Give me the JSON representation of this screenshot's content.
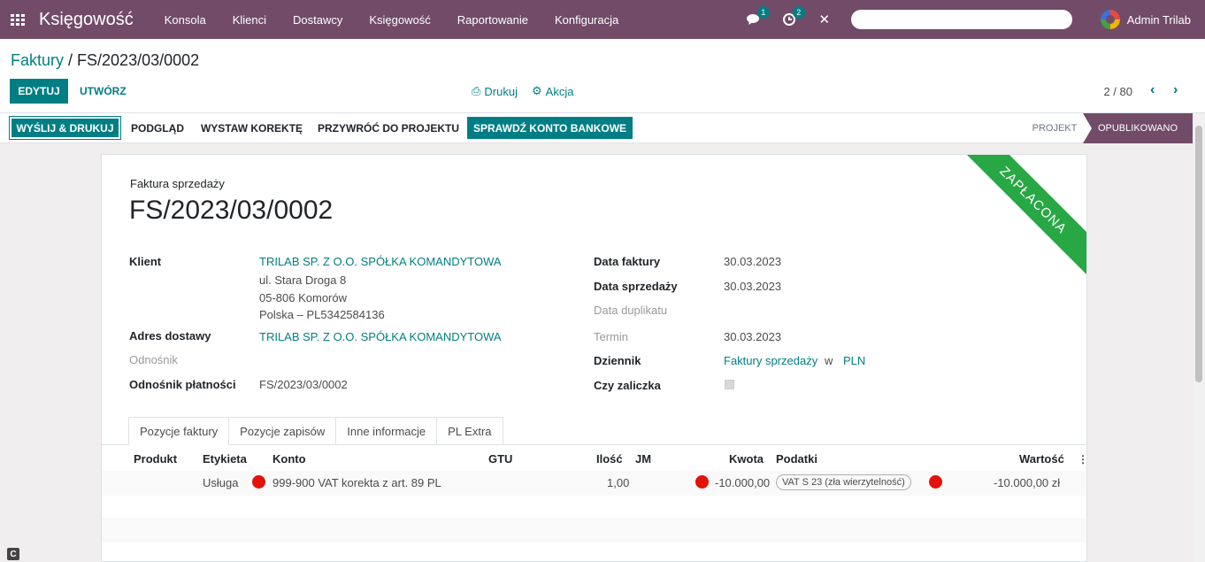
{
  "topbar": {
    "app_title": "Księgowość",
    "menu": [
      "Konsola",
      "Klienci",
      "Dostawcy",
      "Księgowość",
      "Raportowanie",
      "Konfiguracja"
    ],
    "messages_badge": "1",
    "activity_badge": "2",
    "user_name": "Admin Trilab"
  },
  "breadcrumb": {
    "parent": "Faktury",
    "separator": " / ",
    "current": "FS/2023/03/0002"
  },
  "toolbar": {
    "edit_label": "Edytuj",
    "create_label": "Utwórz",
    "print_label": "Drukuj",
    "action_label": "Akcja",
    "pager_value": "2 / 80"
  },
  "statusbar": {
    "buttons": [
      "Wyślij & Drukuj",
      "Podgląd",
      "Wystaw korektę",
      "Przywróć do projektu",
      "Sprawdź konto bankowe"
    ],
    "stages": [
      "Projekt",
      "Opublikowano"
    ],
    "active_stage": "Opublikowano"
  },
  "invoice": {
    "ribbon": "Zapłacona",
    "type_label": "Faktura sprzedaży",
    "number": "FS/2023/03/0002",
    "left_fields": {
      "client_label": "Klient",
      "client_name": "TRILAB SP. Z O.O. SPÓŁKA KOMANDYTOWA",
      "client_address_line1": "ul. Stara Droga 8",
      "client_address_line2": "05-806 Komorów",
      "client_address_line3": "Polska – PL5342584136",
      "delivery_label": "Adres dostawy",
      "delivery_value": "TRILAB SP. Z O.O. SPÓŁKA KOMANDYTOWA",
      "reference_label": "Odnośnik",
      "payment_ref_label": "Odnośnik płatności",
      "payment_ref_value": "FS/2023/03/0002"
    },
    "right_fields": {
      "invoice_date_label": "Data faktury",
      "invoice_date_value": "30.03.2023",
      "sale_date_label": "Data sprzedaży",
      "sale_date_value": "30.03.2023",
      "duplicate_date_label": "Data duplikatu",
      "due_label": "Termin",
      "due_value": "30.03.2023",
      "journal_label": "Dziennik",
      "journal_value": "Faktury sprzedaży",
      "journal_in": "w",
      "currency": "PLN",
      "advance_label": "Czy zaliczka"
    },
    "tabs": [
      "Pozycje faktury",
      "Pozycje zapisów",
      "Inne informacje",
      "PL Extra"
    ],
    "table": {
      "headers": [
        "Produkt",
        "Etykieta",
        "Konto",
        "GTU",
        "Ilość",
        "JM",
        "Kwota",
        "Podatki",
        "Wartość"
      ],
      "rows": [
        {
          "product": "",
          "label": "Usługa",
          "account": "999-900 VAT korekta z art. 89 PL",
          "gtu": "",
          "qty": "1,00",
          "uom": "",
          "price": "-10.000,00",
          "tax": "VAT S 23 (zła wierzytelność)",
          "subtotal": "-10.000,00 zł"
        }
      ]
    }
  }
}
